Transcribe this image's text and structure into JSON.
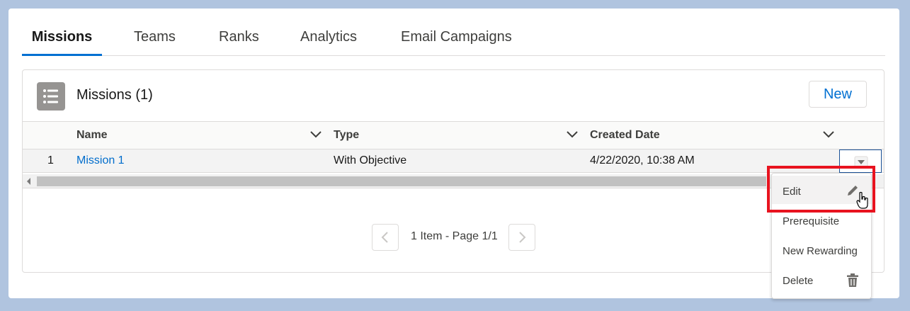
{
  "tabs": [
    {
      "label": "Missions",
      "active": true
    },
    {
      "label": "Teams"
    },
    {
      "label": "Ranks"
    },
    {
      "label": "Analytics"
    },
    {
      "label": "Email Campaigns"
    }
  ],
  "panel": {
    "icon": "list-icon",
    "title": "Missions (1)",
    "new_button": "New"
  },
  "table": {
    "columns": [
      "Name",
      "Type",
      "Created Date"
    ],
    "rows": [
      {
        "index": "1",
        "name": "Mission 1",
        "type": "With Objective",
        "created": "4/22/2020, 10:38 AM"
      }
    ]
  },
  "pagination": {
    "text": "1 Item - Page 1/1"
  },
  "row_menu": {
    "items": [
      {
        "label": "Edit",
        "icon": "pencil-icon"
      },
      {
        "label": "Prerequisite"
      },
      {
        "label": "New Rewarding"
      },
      {
        "label": "Delete",
        "icon": "trash-icon"
      }
    ]
  },
  "colors": {
    "accent": "#0070d2",
    "highlight": "#e8131f",
    "link": "#006dcc"
  }
}
